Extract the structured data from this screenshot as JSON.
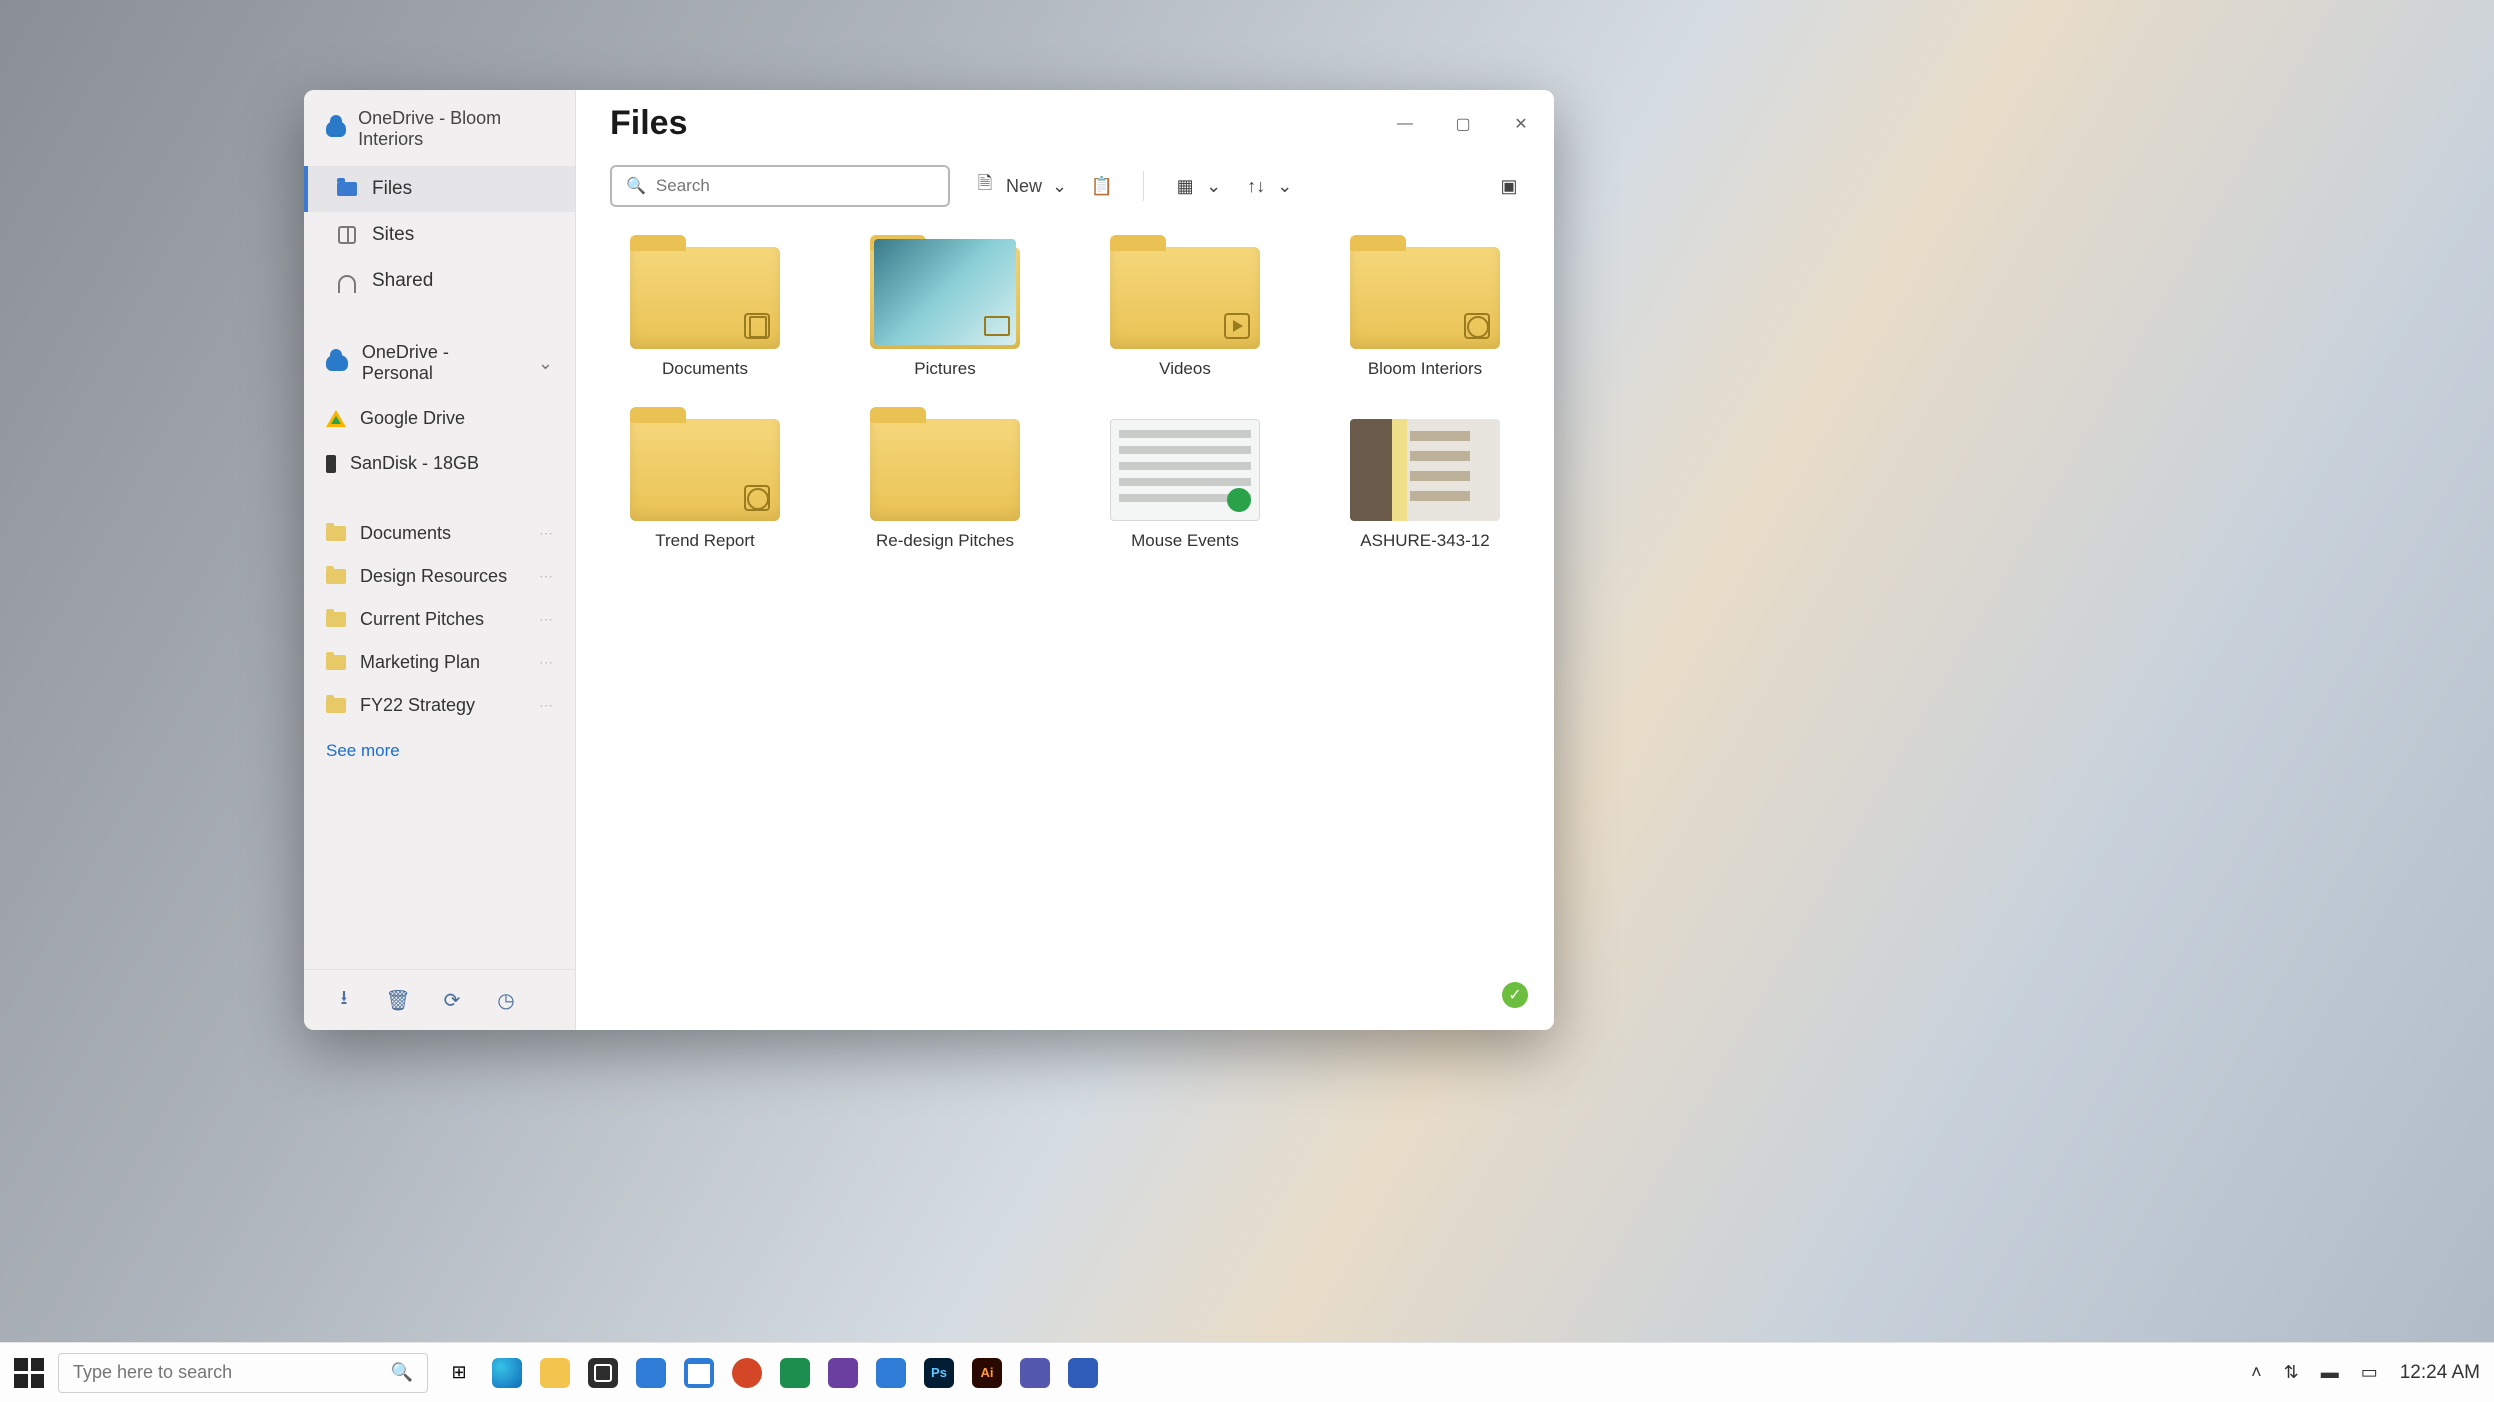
{
  "window": {
    "account_title": "OneDrive - Bloom Interiors",
    "title": "Files",
    "controls": {
      "min": "—",
      "max": "▢",
      "close": "✕"
    }
  },
  "sidebar": {
    "nav": [
      {
        "label": "Files",
        "active": true
      },
      {
        "label": "Sites",
        "active": false
      },
      {
        "label": "Shared",
        "active": false
      }
    ],
    "accounts": [
      {
        "label": "OneDrive - Personal",
        "icon": "cloud",
        "expandable": true
      },
      {
        "label": "Google Drive",
        "icon": "gdrive",
        "expandable": false
      },
      {
        "label": "SanDisk - 18GB",
        "icon": "usb",
        "expandable": false
      }
    ],
    "pinned": [
      {
        "label": "Documents"
      },
      {
        "label": "Design Resources"
      },
      {
        "label": "Current Pitches"
      },
      {
        "label": "Marketing Plan"
      },
      {
        "label": "FY22 Strategy"
      }
    ],
    "see_more": "See more"
  },
  "toolbar": {
    "search_placeholder": "Search",
    "new_label": "New"
  },
  "grid": {
    "items": [
      {
        "label": "Documents",
        "type": "folder",
        "badge": "doc"
      },
      {
        "label": "Pictures",
        "type": "folder-preview"
      },
      {
        "label": "Videos",
        "type": "folder",
        "badge": "vid"
      },
      {
        "label": "Bloom Interiors",
        "type": "folder",
        "badge": "share"
      },
      {
        "label": "Trend Report",
        "type": "folder",
        "badge": "share"
      },
      {
        "label": "Re-design Pitches",
        "type": "folder"
      },
      {
        "label": "Mouse Events",
        "type": "doc"
      },
      {
        "label": "ASHURE-343-12",
        "type": "image"
      }
    ]
  },
  "taskbar": {
    "search_placeholder": "Type here to search",
    "clock": "12:24 AM"
  }
}
